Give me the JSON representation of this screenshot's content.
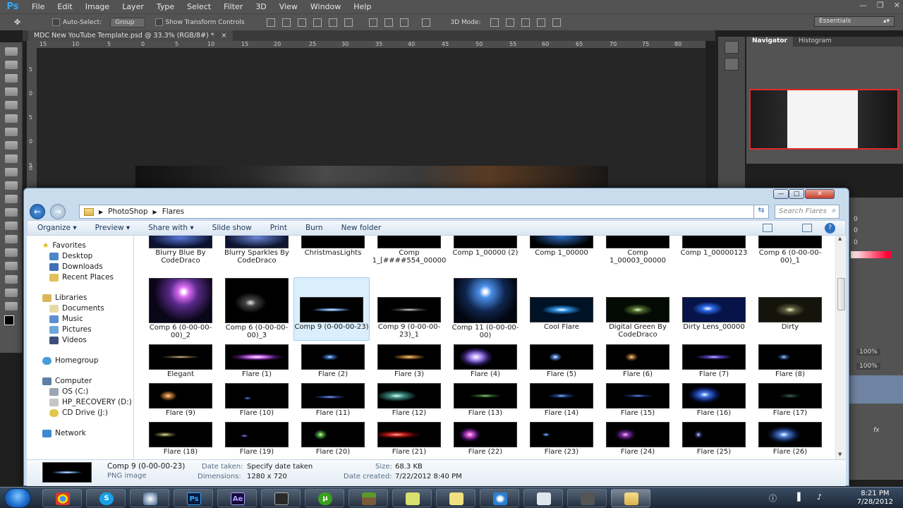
{
  "ps": {
    "logo": "Ps",
    "menu": [
      "File",
      "Edit",
      "Image",
      "Layer",
      "Type",
      "Select",
      "Filter",
      "3D",
      "View",
      "Window",
      "Help"
    ],
    "options": {
      "auto_select": "Auto-Select:",
      "group": "Group",
      "show_transform": "Show Transform Controls",
      "mode_3d": "3D Mode:"
    },
    "workspace": "Essentials",
    "doc_tab": "MDC New YouTube Template.psd @ 33.3% (RGB/8#) *",
    "doc_tab_close": "×",
    "ruler_top": [
      "15",
      "10",
      "5",
      "0",
      "5",
      "10",
      "15",
      "20",
      "25",
      "30",
      "35",
      "40",
      "45",
      "50",
      "55",
      "60",
      "65",
      "70",
      "75",
      "80"
    ],
    "ruler_left": [
      "5",
      "0",
      "5",
      "0",
      "5",
      "0"
    ],
    "navigator_tabs": [
      "Navigator",
      "Histogram"
    ],
    "right_panel": {
      "opacity": "100%",
      "fill": "100%",
      "zero": "0",
      "fx": "fx"
    }
  },
  "explorer": {
    "breadcrumb": [
      "PhotoShop",
      "Flares"
    ],
    "search_placeholder": "Search Flares",
    "commands": [
      "Organize ▾",
      "Preview ▾",
      "Share with ▾",
      "Slide show",
      "Print",
      "Burn",
      "New folder"
    ],
    "nav": {
      "favorites": "Favorites",
      "favorites_items": [
        "Desktop",
        "Downloads",
        "Recent Places"
      ],
      "libraries": "Libraries",
      "libraries_items": [
        "Documents",
        "Music",
        "Pictures",
        "Videos"
      ],
      "homegroup": "Homegroup",
      "computer": "Computer",
      "computer_items": [
        "OS (C:)",
        "HP_RECOVERY (D:)",
        "CD Drive (J:)"
      ],
      "network": "Network"
    },
    "row0": [
      "Blurry Blue By CodeDraco",
      "Blurry Sparkles By CodeDraco",
      "ChristmasLights",
      "Comp 1_[####554_00000",
      "Comp 1_00000 (2)",
      "Comp 1_00000",
      "Comp 1_00003_00000",
      "Comp 1_00000123",
      "Comp 6 (0-00-00-00)_1"
    ],
    "row1": [
      "Comp 6 (0-00-00-00)_2",
      "Comp 6 (0-00-00-00)_3",
      "Comp 9 (0-00-00-23)",
      "Comp 9 (0-00-00-23)_1",
      "Comp 11 (0-00-00-00)",
      "Cool Flare",
      "Digital Green By CodeDraco",
      "Dirty Lens_00000",
      "Dirty"
    ],
    "row2": [
      "Elegant",
      "Flare (1)",
      "Flare (2)",
      "Flare (3)",
      "Flare (4)",
      "Flare (5)",
      "Flare (6)",
      "Flare (7)",
      "Flare (8)"
    ],
    "row3": [
      "Flare (9)",
      "Flare (10)",
      "Flare (11)",
      "Flare (12)",
      "Flare (13)",
      "Flare (14)",
      "Flare (15)",
      "Flare (16)",
      "Flare (17)"
    ],
    "row4": [
      "Flare (18)",
      "Flare (19)",
      "Flare (20)",
      "Flare (21)",
      "Flare (22)",
      "Flare (23)",
      "Flare (24)",
      "Flare (25)",
      "Flare (26)"
    ],
    "details": {
      "name": "Comp 9 (0-00-00-23)",
      "type": "PNG image",
      "date_taken_label": "Date taken:",
      "date_taken_value": "Specify date taken",
      "dimensions_label": "Dimensions:",
      "dimensions_value": "1280 x 720",
      "size_label": "Size:",
      "size_value": "68.3 KB",
      "created_label": "Date created:",
      "created_value": "7/22/2012 8:40 PM"
    }
  },
  "taskbar": {
    "time": "8:21 PM",
    "date": "7/28/2012",
    "apps": [
      "chrome-icon",
      "skype-icon",
      "cinema4d-icon",
      "photoshop-icon",
      "after-effects-icon",
      "media-icon",
      "utorrent-icon",
      "minecraft-icon",
      "notes-icon",
      "sticky-icon",
      "ie-icon",
      "calculator-icon",
      "camera-icon",
      "explorer-icon"
    ],
    "app_labels": {
      "photoshop": "Ps",
      "after_effects": "Ae",
      "skype": "S"
    }
  }
}
